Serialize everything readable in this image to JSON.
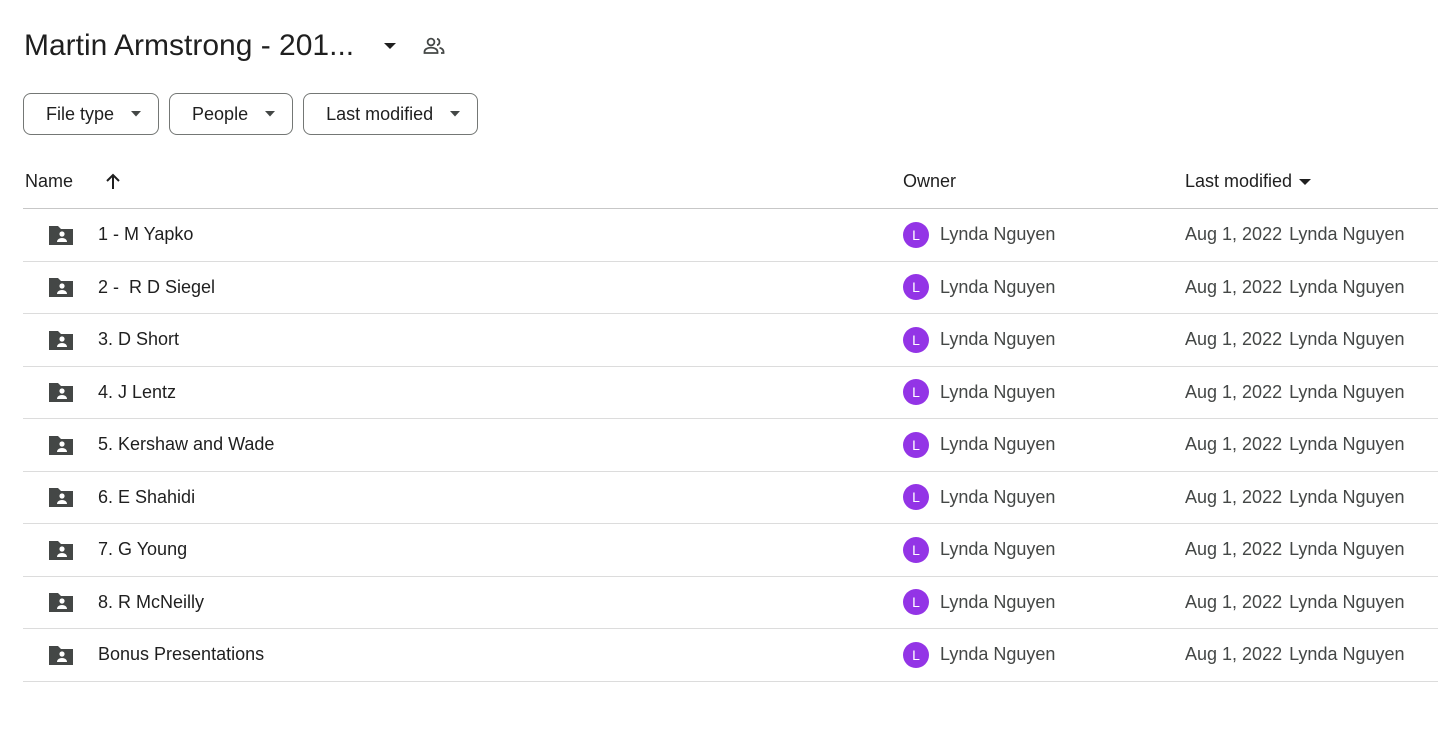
{
  "header": {
    "title": "Martin Armstrong - 201...",
    "icons": {
      "caret": "arrow-drop-down-icon",
      "shared": "people-icon"
    }
  },
  "filters": [
    {
      "label": "File type"
    },
    {
      "label": "People"
    },
    {
      "label": "Last modified"
    }
  ],
  "table": {
    "columns": {
      "name": "Name",
      "owner": "Owner",
      "modified": "Last modified"
    },
    "avatar_color": "#9334e6",
    "rows": [
      {
        "name": "1 - M Yapko",
        "owner_initial": "L",
        "owner": "Lynda Nguyen",
        "date": "Aug 1, 2022",
        "modifier": "Lynda Nguyen"
      },
      {
        "name": "2 -  R D Siegel",
        "owner_initial": "L",
        "owner": "Lynda Nguyen",
        "date": "Aug 1, 2022",
        "modifier": "Lynda Nguyen"
      },
      {
        "name": "3. D Short",
        "owner_initial": "L",
        "owner": "Lynda Nguyen",
        "date": "Aug 1, 2022",
        "modifier": "Lynda Nguyen"
      },
      {
        "name": "4. J Lentz",
        "owner_initial": "L",
        "owner": "Lynda Nguyen",
        "date": "Aug 1, 2022",
        "modifier": "Lynda Nguyen"
      },
      {
        "name": "5. Kershaw and Wade",
        "owner_initial": "L",
        "owner": "Lynda Nguyen",
        "date": "Aug 1, 2022",
        "modifier": "Lynda Nguyen"
      },
      {
        "name": "6. E Shahidi",
        "owner_initial": "L",
        "owner": "Lynda Nguyen",
        "date": "Aug 1, 2022",
        "modifier": "Lynda Nguyen"
      },
      {
        "name": "7. G Young",
        "owner_initial": "L",
        "owner": "Lynda Nguyen",
        "date": "Aug 1, 2022",
        "modifier": "Lynda Nguyen"
      },
      {
        "name": "8. R McNeilly",
        "owner_initial": "L",
        "owner": "Lynda Nguyen",
        "date": "Aug 1, 2022",
        "modifier": "Lynda Nguyen"
      },
      {
        "name": "Bonus Presentations",
        "owner_initial": "L",
        "owner": "Lynda Nguyen",
        "date": "Aug 1, 2022",
        "modifier": "Lynda Nguyen"
      }
    ]
  }
}
